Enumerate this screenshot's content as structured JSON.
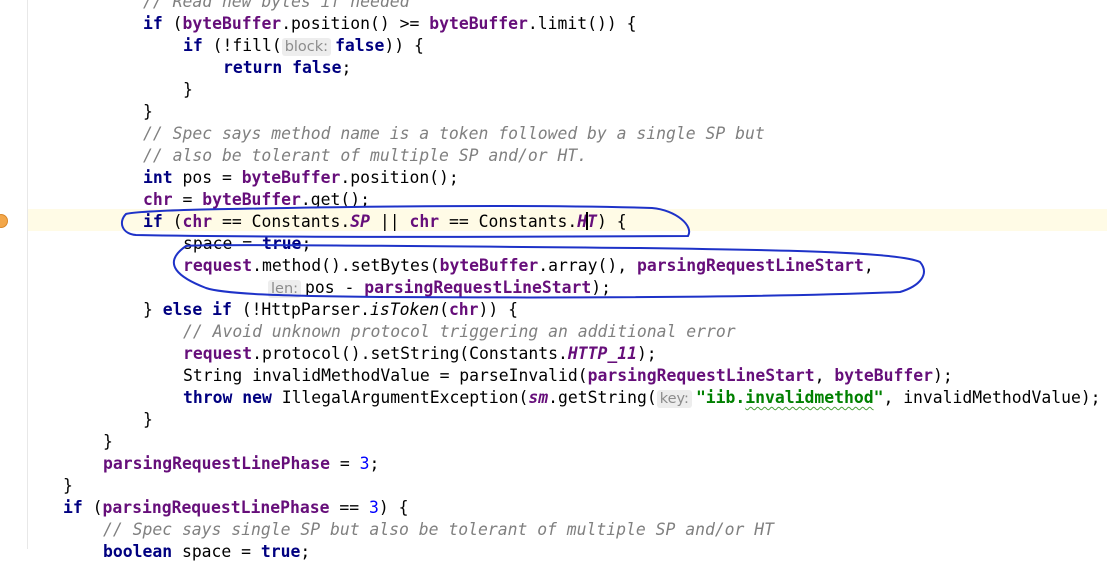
{
  "editor": {
    "lines": {
      "l00": {
        "a": "// Read new bytes if needed"
      },
      "l01": {
        "k1": "if",
        "a": " (",
        "f1": "byteBuffer",
        "b": ".position() >= ",
        "f2": "byteBuffer",
        "c": ".limit()) {"
      },
      "l02": {
        "k1": "if",
        "a": " (!fill(",
        "h1": "block:",
        "k2": "false",
        "b": ")) {"
      },
      "l03": {
        "k1": "return",
        "k2": "false",
        "a": ";"
      },
      "l04": {
        "a": "}"
      },
      "l05": {
        "a": "}"
      },
      "l06": {
        "a": "// Spec says method name is a token followed by a single SP but"
      },
      "l07": {
        "a": "// also be tolerant of multiple SP and/or HT."
      },
      "l08": {
        "k1": "int",
        "a": " pos = ",
        "f1": "byteBuffer",
        "b": ".position();"
      },
      "l09": {
        "f1": "chr",
        "a": " = ",
        "f2": "byteBuffer",
        "b": ".get();"
      },
      "l10": {
        "k1": "if",
        "a": " (",
        "f1": "chr",
        "b": " == Constants.",
        "s1": "SP",
        "c": " || ",
        "f2": "chr",
        "d": " == Constants.",
        "s2a": "H",
        "s2b": "T",
        "e": ") {"
      },
      "l11": {
        "a": "space",
        "b": " = ",
        "k1": "true",
        "c": ";"
      },
      "l12": {
        "f1": "request",
        "a": ".method().setBytes(",
        "f2": "byteBuffer",
        "b": ".array(), ",
        "f3": "parsingRequestLineStart",
        "c": ","
      },
      "l13": {
        "h1": "len:",
        "a": "pos - ",
        "f1": "parsingRequestLineStart",
        "b": ");"
      },
      "l14": {
        "a": "} ",
        "k1": "else if",
        "b": " (!HttpParser.",
        "m1": "isToken",
        "c": "(",
        "f1": "chr",
        "d": ")) {"
      },
      "l15": {
        "a": "// Avoid unknown protocol triggering an additional error"
      },
      "l16": {
        "f1": "request",
        "a": ".protocol().setString(Constants.",
        "s1": "HTTP_11",
        "b": ");"
      },
      "l17": {
        "a": "String invalidMethodValue = parseInvalid(",
        "f1": "parsingRequestLineStart",
        "b": ", ",
        "f2": "byteBuffer",
        "c": ");"
      },
      "l18": {
        "k1": "throw",
        "k2": "new",
        "a": " IllegalArgumentException(",
        "f1": "sm",
        "b": ".getString(",
        "h1": "key:",
        "st1": "\"iib.",
        "st2": "invalidmethod",
        "st3": "\"",
        "c": ", invalidMethodValue);"
      },
      "l19": {
        "a": "}"
      },
      "l20": {
        "a": "}"
      },
      "l21": {
        "f1": "parsingRequestLinePhase",
        "a": " = ",
        "n1": "3",
        "b": ";"
      },
      "l22": {
        "a": "}"
      },
      "l23": {
        "k1": "if",
        "a": " (",
        "f1": "parsingRequestLinePhase",
        "b": " == ",
        "n1": "3",
        "c": ") {"
      },
      "l24": {
        "a": "// Spec says single SP but also be tolerant of multiple SP and/or HT"
      },
      "l25": {
        "k1": "boolean",
        "a": " space = ",
        "k2": "true",
        "b": ";"
      }
    }
  }
}
